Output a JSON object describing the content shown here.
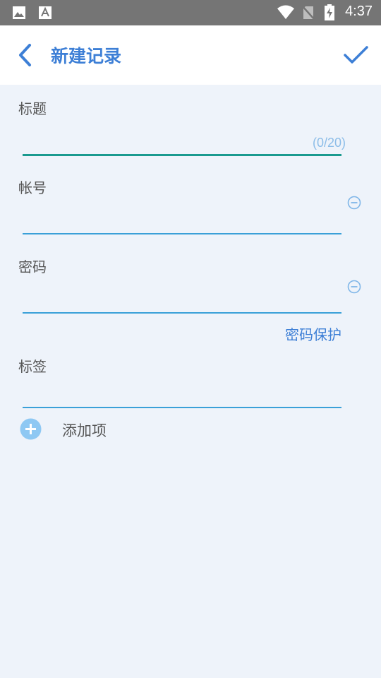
{
  "status_bar": {
    "time": "4:37",
    "icons": [
      "image-icon",
      "text-a-icon",
      "wifi-icon",
      "no-sim-icon",
      "battery-charging-icon"
    ]
  },
  "app_bar": {
    "title": "新建记录",
    "back_icon": "chevron-left-icon",
    "confirm_icon": "check-icon",
    "accent_color": "#3d7fd6"
  },
  "form": {
    "title": {
      "label": "标题",
      "value": "",
      "counter": "(0/20)",
      "underline_color": "#1a9a8f"
    },
    "account": {
      "label": "帐号",
      "value": "",
      "remove_icon": "minus-circle-icon"
    },
    "password": {
      "label": "密码",
      "value": "",
      "remove_icon": "minus-circle-icon",
      "protect_link": "密码保护"
    },
    "tags": {
      "label": "标签",
      "value": ""
    },
    "add_item": {
      "label": "添加项",
      "icon": "plus-circle-icon"
    }
  }
}
